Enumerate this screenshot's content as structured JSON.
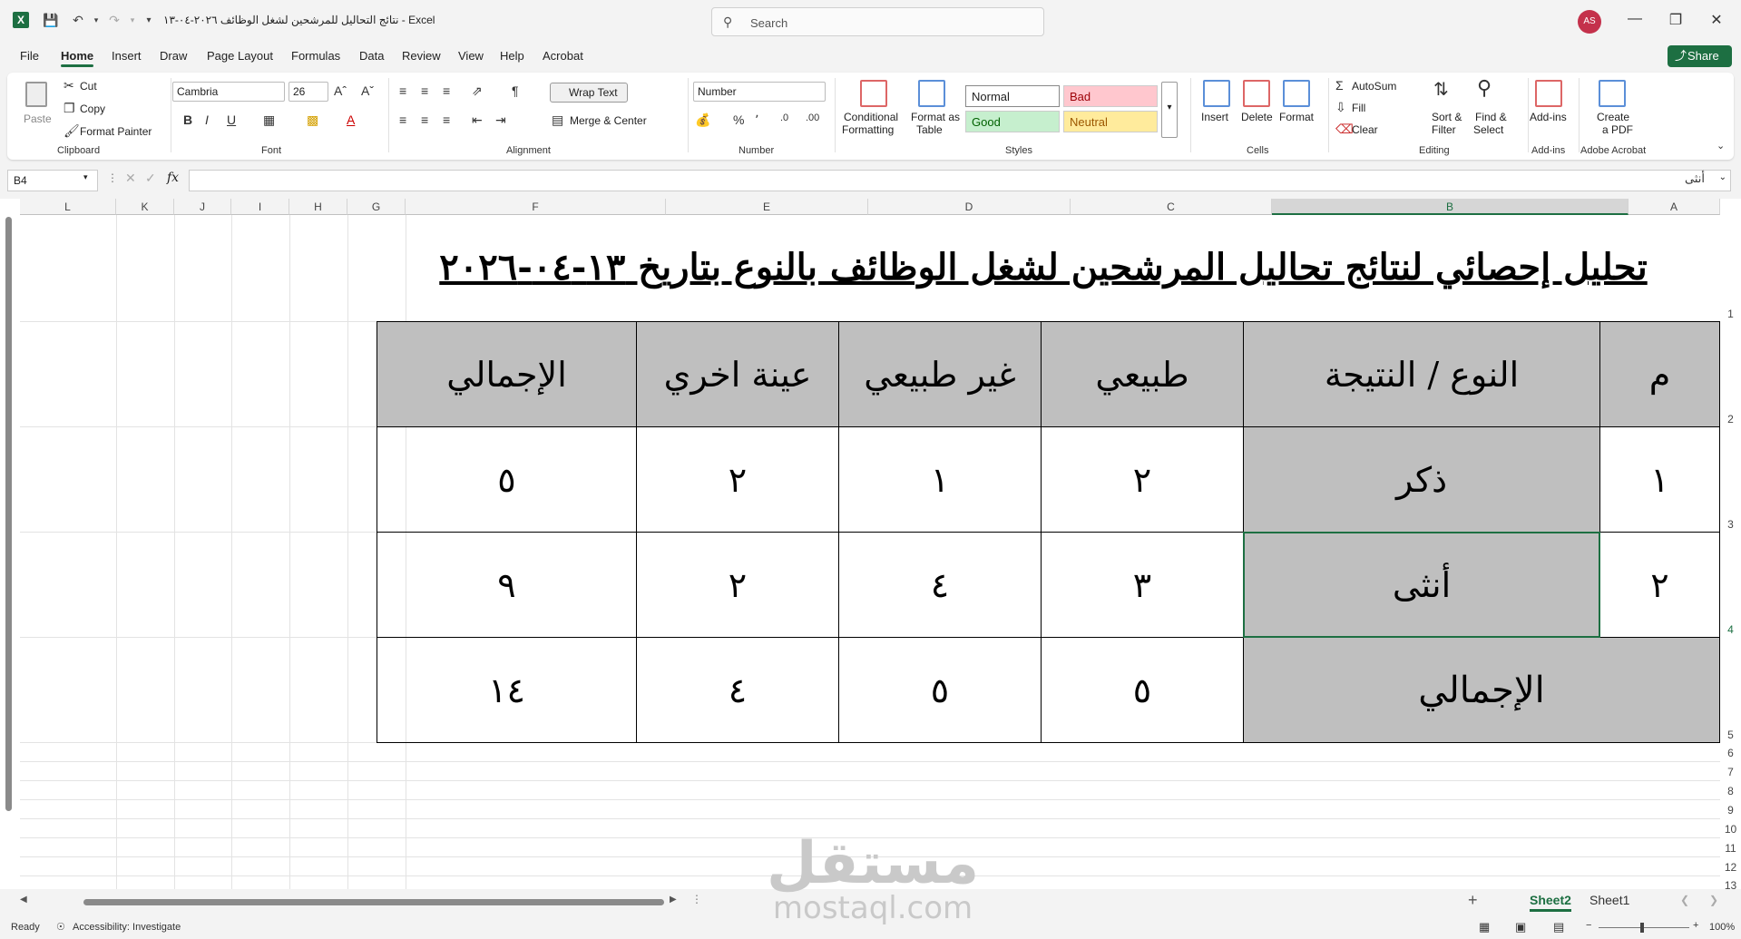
{
  "window": {
    "doc_title": "نتائج التحاليل للمرشحين لشغل الوظائف ٢٠٢٦-٠٤-١٣  -  Excel",
    "search_placeholder": "Search",
    "avatar": "AS"
  },
  "menu": {
    "tabs": [
      "File",
      "Home",
      "Insert",
      "Draw",
      "Page Layout",
      "Formulas",
      "Data",
      "Review",
      "View",
      "Help",
      "Acrobat"
    ],
    "active": "Home",
    "share": "Share"
  },
  "ribbon": {
    "clipboard": {
      "paste": "Paste",
      "cut": "Cut",
      "copy": "Copy",
      "format_painter": "Format Painter",
      "label": "Clipboard"
    },
    "font": {
      "name": "Cambria",
      "size": "26",
      "label": "Font"
    },
    "alignment": {
      "wrap_text": "Wrap Text",
      "merge_center": "Merge & Center",
      "label": "Alignment"
    },
    "number": {
      "format": "Number",
      "label": "Number"
    },
    "styles": {
      "conditional": "Conditional",
      "conditional2": "Formatting",
      "format_as": "Format as",
      "format_as2": "Table",
      "normal": "Normal",
      "bad": "Bad",
      "good": "Good",
      "neutral": "Neutral",
      "label": "Styles"
    },
    "cells": {
      "insert": "Insert",
      "delete": "Delete",
      "format": "Format",
      "label": "Cells"
    },
    "editing": {
      "autosum": "AutoSum",
      "fill": "Fill",
      "clear": "Clear",
      "sort": "Sort &",
      "sort2": "Filter",
      "find": "Find &",
      "find2": "Select",
      "label": "Editing"
    },
    "addins": {
      "addins": "Add-ins",
      "label": "Add-ins"
    },
    "acrobat": {
      "create": "Create",
      "create2": "a PDF",
      "label": "Adobe Acrobat"
    }
  },
  "formula_bar": {
    "name_box": "B4",
    "fx": "fx",
    "value": "أنثى"
  },
  "columns": [
    "L",
    "K",
    "J",
    "I",
    "H",
    "G",
    "F",
    "E",
    "D",
    "C",
    "B",
    "A"
  ],
  "rows": [
    "1",
    "2",
    "3",
    "4",
    "5",
    "6",
    "7",
    "8",
    "9",
    "10",
    "11",
    "12",
    "13"
  ],
  "sheet": {
    "title": "تحليل إحصائي لنتائج تحاليل المرشحين لشغل الوظائف بالنوع بتاريخ ١٣-٠٤-٢٠٢٦",
    "headers": {
      "a": "م",
      "b": "النوع / النتيجة",
      "c": "طبيعي",
      "d": "غير طبيعي",
      "e": "عينة اخري",
      "f": "الإجمالي"
    },
    "rows": [
      {
        "a": "١",
        "b": "ذكر",
        "c": "٢",
        "d": "١",
        "e": "٢",
        "f": "٥"
      },
      {
        "a": "٢",
        "b": "أنثى",
        "c": "٣",
        "d": "٤",
        "e": "٢",
        "f": "٩"
      }
    ],
    "total": {
      "label": "الإجمالي",
      "c": "٥",
      "d": "٥",
      "e": "٤",
      "f": "١٤"
    }
  },
  "sheet_tabs": {
    "tabs": [
      "Sheet2",
      "Sheet1"
    ],
    "active": "Sheet2"
  },
  "status": {
    "ready": "Ready",
    "accessibility": "Accessibility: Investigate",
    "zoom": "100%"
  },
  "watermark": {
    "ar": "مستقل",
    "en": "mostaql.com"
  },
  "colors": {
    "excel_green": "#1d6f42",
    "header_gray": "#bfbfbf"
  }
}
